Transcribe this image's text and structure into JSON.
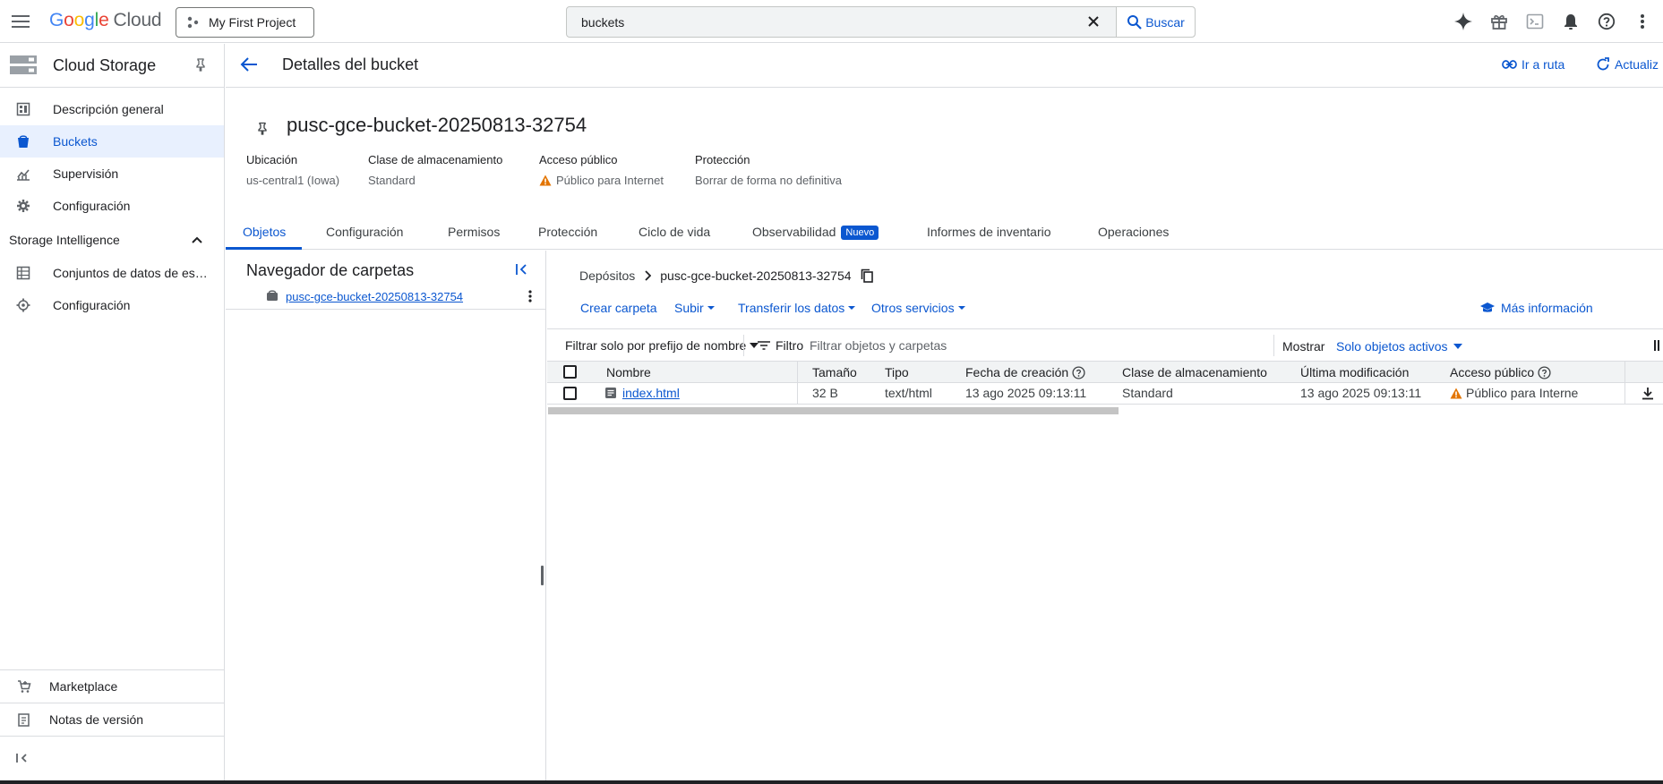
{
  "topbar": {
    "logo": {
      "g": "G",
      "o1": "o",
      "o2": "o",
      "g2": "g",
      "l": "l",
      "e": "e",
      "cloud": "Cloud"
    },
    "project": "My First Project",
    "search_value": "buckets",
    "search_button": "Buscar",
    "icons": [
      "gemini-icon",
      "gift-icon",
      "terminal-icon",
      "bell-icon",
      "help-icon",
      "more-vert-icon"
    ]
  },
  "sidebar": {
    "product": "Cloud Storage",
    "items": [
      {
        "label": "Descripción general",
        "icon": "dashboard-icon"
      },
      {
        "label": "Buckets",
        "icon": "bucket-icon",
        "active": true
      },
      {
        "label": "Supervisión",
        "icon": "chart-icon"
      },
      {
        "label": "Configuración",
        "icon": "gear-icon"
      }
    ],
    "section": "Storage Intelligence",
    "section_items": [
      {
        "label": "Conjuntos de datos de es…",
        "icon": "dataset-icon"
      },
      {
        "label": "Configuración",
        "icon": "gear-outline-icon"
      }
    ],
    "bottom": [
      {
        "label": "Marketplace",
        "icon": "cart-icon"
      },
      {
        "label": "Notas de versión",
        "icon": "notes-icon"
      }
    ]
  },
  "header": {
    "title": "Detalles del bucket",
    "goto_path": "Ir a ruta",
    "refresh": "Actualiz"
  },
  "bucket": {
    "name": "pusc-gce-bucket-20250813-32754",
    "meta": [
      {
        "key": "Ubicación",
        "value": "us-central1 (Iowa)"
      },
      {
        "key": "Clase de almacenamiento",
        "value": "Standard"
      },
      {
        "key": "Acceso público",
        "value": "Público para Internet",
        "warning": true
      },
      {
        "key": "Protección",
        "value": "Borrar de forma no definitiva"
      }
    ]
  },
  "tabs": [
    {
      "label": "Objetos",
      "active": true
    },
    {
      "label": "Configuración"
    },
    {
      "label": "Permisos"
    },
    {
      "label": "Protección"
    },
    {
      "label": "Ciclo de vida"
    },
    {
      "label": "Observabilidad",
      "badge": "Nuevo"
    },
    {
      "label": "Informes de inventario"
    },
    {
      "label": "Operaciones"
    }
  ],
  "folder_nav": {
    "title": "Navegador de carpetas",
    "bucket": "pusc-gce-bucket-20250813-32754"
  },
  "objects": {
    "breadcrumb": [
      "Depósitos",
      "pusc-gce-bucket-20250813-32754"
    ],
    "actions": [
      "Crear carpeta",
      "Subir",
      "Transferir los datos",
      "Otros servicios"
    ],
    "more_info": "Más información",
    "filter_prefix": "Filtrar solo por prefijo de nombre",
    "filter_label": "Filtro",
    "filter_placeholder": "Filtrar objetos y carpetas",
    "show_label": "Mostrar",
    "show_value": "Solo objetos activos",
    "columns": [
      "Nombre",
      "Tamaño",
      "Tipo",
      "Fecha de creación",
      "Clase de almacenamiento",
      "Última modificación",
      "Acceso público"
    ],
    "rows": [
      {
        "name": "index.html",
        "size": "32 B",
        "type": "text/html",
        "created": "13 ago 2025 09:13:11",
        "class": "Standard",
        "modified": "13 ago 2025 09:13:11",
        "access": "Público para Interne"
      }
    ]
  },
  "colors": {
    "accent": "#0b57d0",
    "warning": "#e37400",
    "active_bg": "#e8f0fe"
  }
}
